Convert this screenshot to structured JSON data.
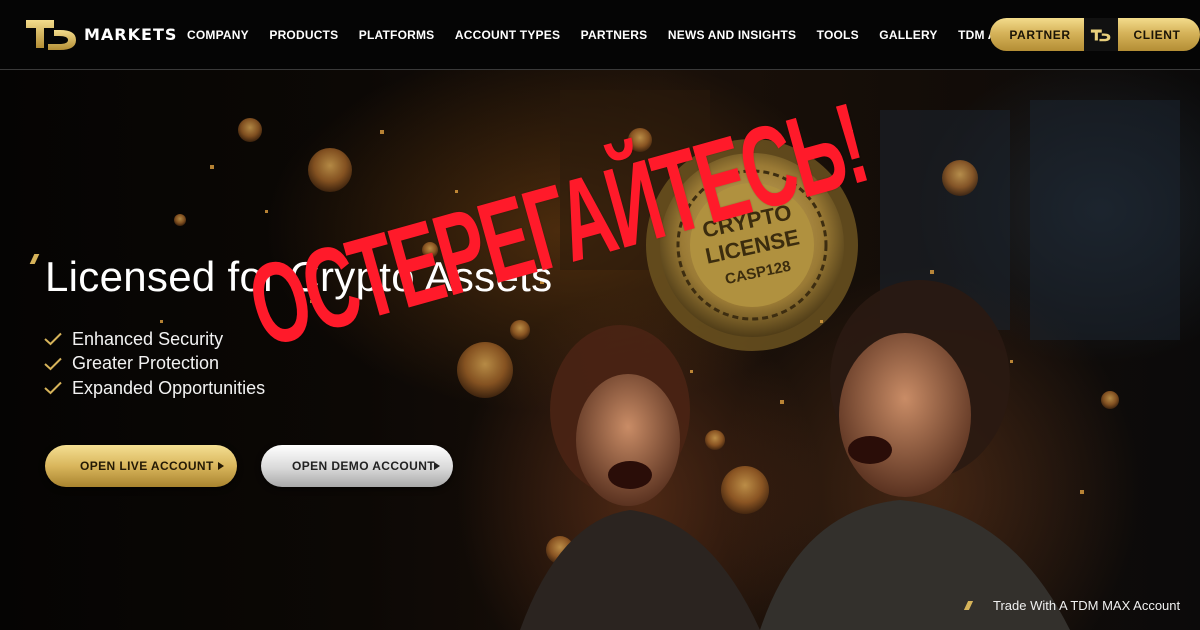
{
  "brand": {
    "logo_text": "MARKETS",
    "accent": "#d6b35a"
  },
  "nav": {
    "items": [
      {
        "label": "COMPANY"
      },
      {
        "label": "PRODUCTS"
      },
      {
        "label": "PLATFORMS"
      },
      {
        "label": "ACCOUNT TYPES"
      },
      {
        "label": "PARTNERS"
      },
      {
        "label": "NEWS AND INSIGHTS"
      },
      {
        "label": "TOOLS"
      },
      {
        "label": "GALLERY"
      },
      {
        "label": "TDM ACADEMY"
      }
    ]
  },
  "auth": {
    "partner_label": "PARTNER",
    "client_label": "CLIENT"
  },
  "hero": {
    "headline": "Licensed for Crypto Assets",
    "features": [
      {
        "label": "Enhanced Security"
      },
      {
        "label": "Greater Protection"
      },
      {
        "label": "Expanded Opportunities"
      }
    ],
    "cta_live": "OPEN LIVE ACCOUNT",
    "cta_demo": "OPEN DEMO ACCOUNT"
  },
  "badge": {
    "line1": "CRYPTO",
    "line2": "LICENSE",
    "line3": "CASP128"
  },
  "warning": {
    "text": "ОСТЕРЕГАЙТЕСЬ!",
    "color": "#ff1a2a"
  },
  "promo": {
    "text": "Trade With A TDM MAX Account"
  },
  "icons": [
    "logo-td-icon",
    "check-icon",
    "arrow-right-icon",
    "coin-icon"
  ]
}
